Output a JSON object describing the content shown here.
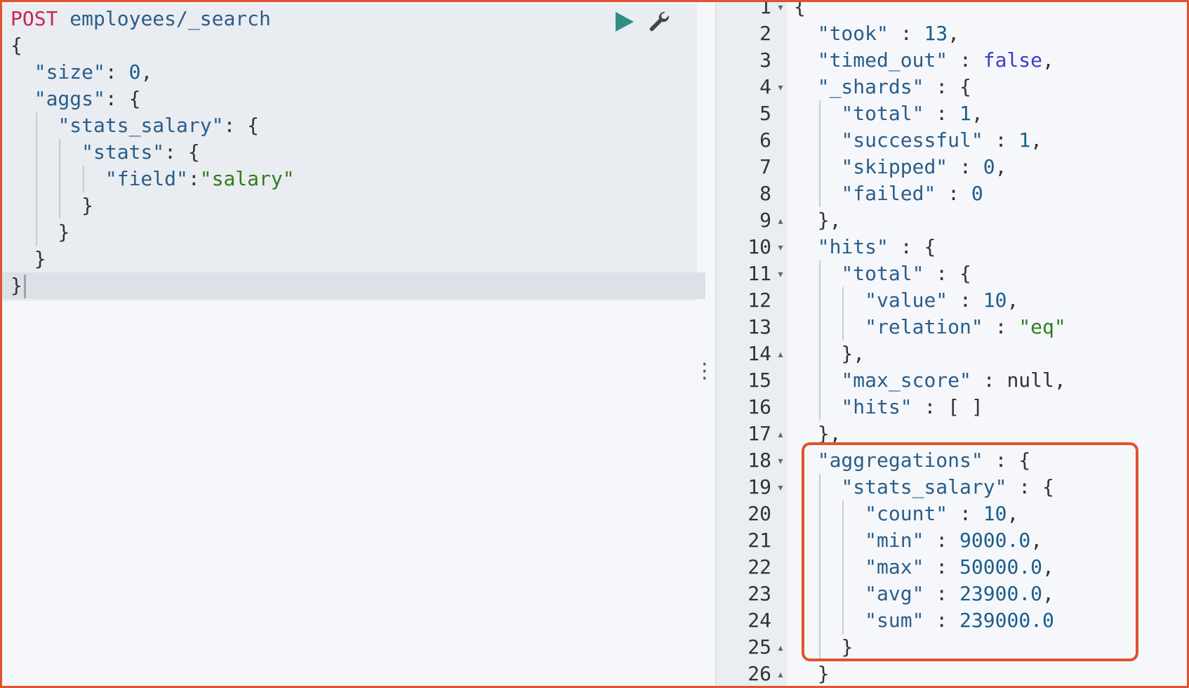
{
  "request": {
    "method": "POST",
    "path": " employees/_search",
    "lines": [
      "{",
      "  \"size\": 0,",
      "  \"aggs\": {",
      "    \"stats_salary\": {",
      "      \"stats\": {",
      "        \"field\":\"salary\"",
      "      }",
      "    }",
      "  }",
      "}"
    ]
  },
  "toolbar": {
    "run_icon": "play-icon",
    "settings_icon": "wrench-icon",
    "play_color": "#2f8f83"
  },
  "response": {
    "line_numbers": [
      "1",
      "2",
      "3",
      "4",
      "5",
      "6",
      "7",
      "8",
      "9",
      "10",
      "11",
      "12",
      "13",
      "14",
      "15",
      "16",
      "17",
      "18",
      "19",
      "20",
      "21",
      "22",
      "23",
      "24",
      "25",
      "26"
    ],
    "lines": [
      "{",
      "  \"took\" : 13,",
      "  \"timed_out\" : false,",
      "  \"_shards\" : {",
      "    \"total\" : 1,",
      "    \"successful\" : 1,",
      "    \"skipped\" : 0,",
      "    \"failed\" : 0",
      "  },",
      "  \"hits\" : {",
      "    \"total\" : {",
      "      \"value\" : 10,",
      "      \"relation\" : \"eq\"",
      "    },",
      "    \"max_score\" : null,",
      "    \"hits\" : [ ]",
      "  },",
      "  \"aggregations\" : {",
      "    \"stats_salary\" : {",
      "      \"count\" : 10,",
      "      \"min\" : 9000.0,",
      "      \"max\" : 50000.0,",
      "      \"avg\" : 23900.0,",
      "      \"sum\" : 239000.0",
      "    }",
      "  }"
    ]
  },
  "highlight_color": "#e0532f"
}
